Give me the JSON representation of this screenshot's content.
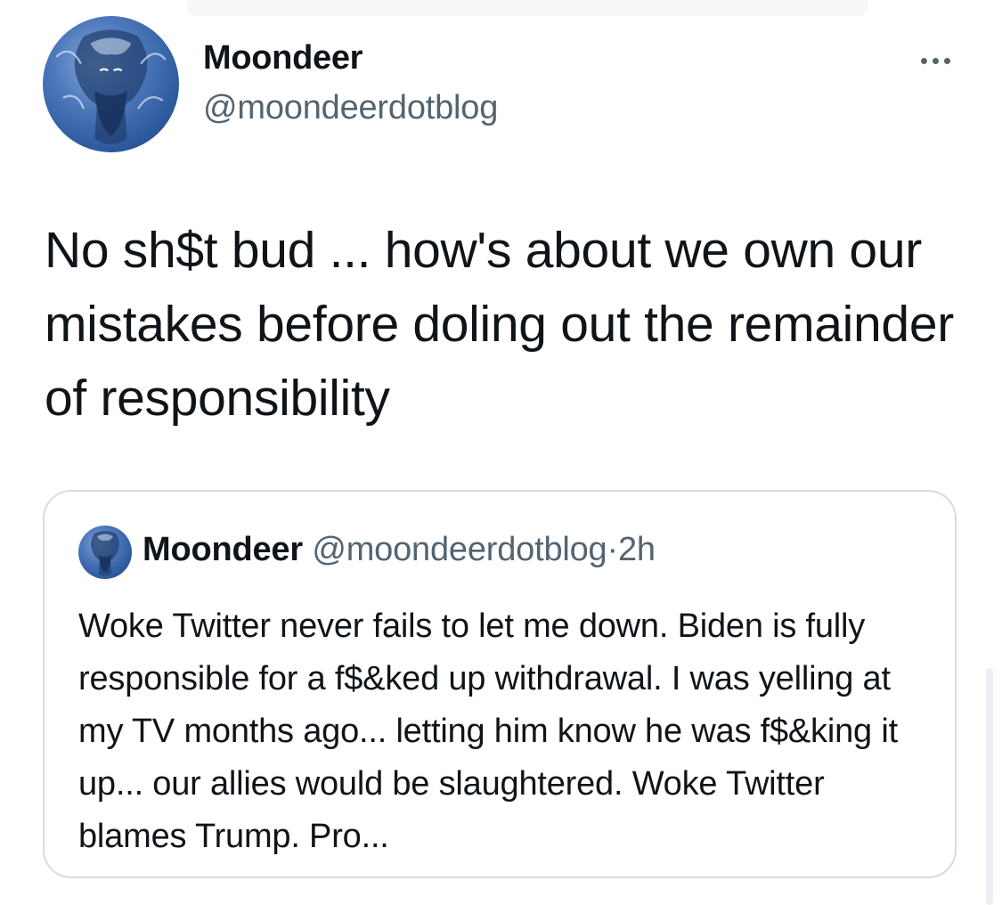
{
  "tweet": {
    "author_name": "Moondeer",
    "author_handle": "@moondeerdotblog",
    "text": "No sh$t bud ... how's about we own our mistakes before doling out the remainder of responsibility",
    "more_icon": "more-horizontal-icon"
  },
  "quoted_tweet": {
    "author_name": "Moondeer",
    "author_handle": "@moondeerdotblog",
    "separator": "·",
    "time": "2h",
    "text": "Woke Twitter never fails to let me down. Biden is fully responsible for a f$&ked up withdrawal. I was yelling at my TV months ago... letting him know he was f$&king it up... our allies would be slaughtered. Woke Twitter blames Trump. Pro..."
  },
  "colors": {
    "text_primary": "#0f1419",
    "text_secondary": "#536471",
    "border": "#d6dbdf",
    "avatar_blue": "#2e5a9e"
  }
}
